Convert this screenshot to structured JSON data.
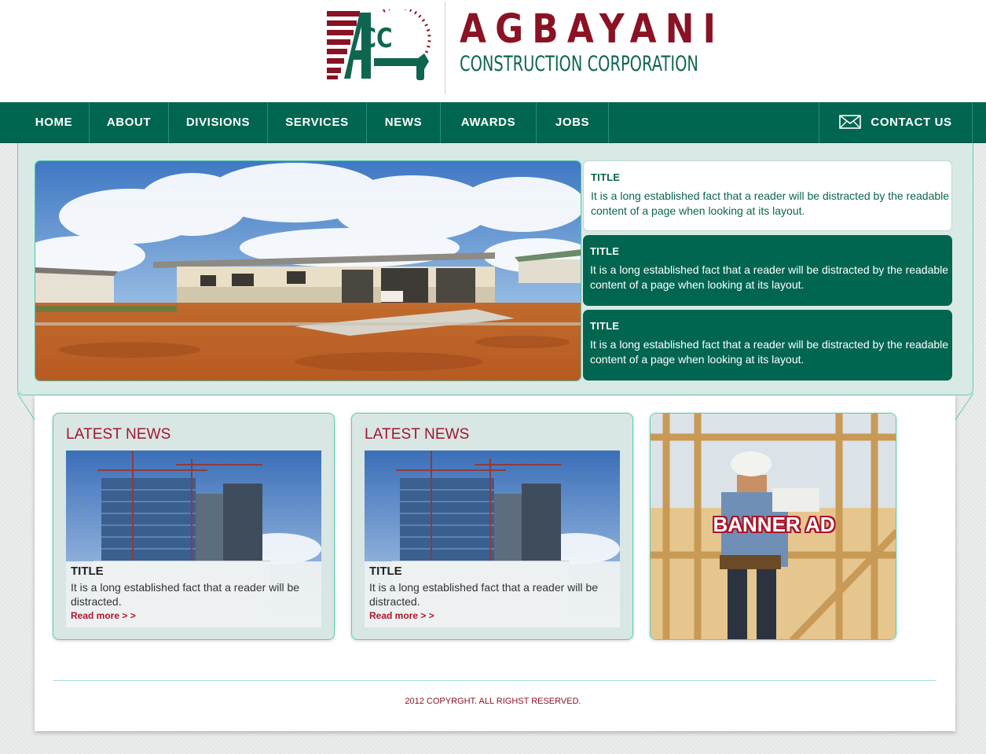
{
  "brand": {
    "logo_initials": "ACC",
    "name": "AGBAYANI",
    "subtitle": "CONSTRUCTION CORPORATION",
    "primary_color": "#006650",
    "accent_color": "#8a1224"
  },
  "nav": {
    "items": [
      {
        "label": "HOME"
      },
      {
        "label": "ABOUT"
      },
      {
        "label": "DIVISIONS"
      },
      {
        "label": "SERVICES"
      },
      {
        "label": "NEWS"
      },
      {
        "label": "AWARDS"
      },
      {
        "label": "JOBS"
      }
    ],
    "contact": {
      "label": "CONTACT US",
      "icon": "envelope-icon"
    }
  },
  "hero": {
    "image": "house-construction-photo",
    "panels": [
      {
        "title": "TITLE",
        "text": "It is a long established fact that a reader will be distracted by the readable content of a page when looking at its layout.",
        "active": true
      },
      {
        "title": "TITLE",
        "text": "It is a long established fact that a reader will be distracted by the readable content of a page when looking at its layout.",
        "active": false
      },
      {
        "title": "TITLE",
        "text": "It is a long established fact that a reader will be distracted by the readable content of a page when looking at its layout.",
        "active": false
      }
    ]
  },
  "news": [
    {
      "heading": "LATEST NEWS",
      "title": "TITLE",
      "text": "It is a long established fact that a reader will be distracted.",
      "link": "Read more > >",
      "image": "building-construction-photo"
    },
    {
      "heading": "LATEST NEWS",
      "title": "TITLE",
      "text": "It is a long established fact that a reader will be distracted.",
      "link": "Read more > >",
      "image": "building-construction-photo"
    }
  ],
  "banner": {
    "label": "BANNER AD",
    "image": "worker-wood-frame-photo"
  },
  "footer": {
    "copyright": "2012 COPYRGHT. ALL RIGHST RESERVED."
  }
}
